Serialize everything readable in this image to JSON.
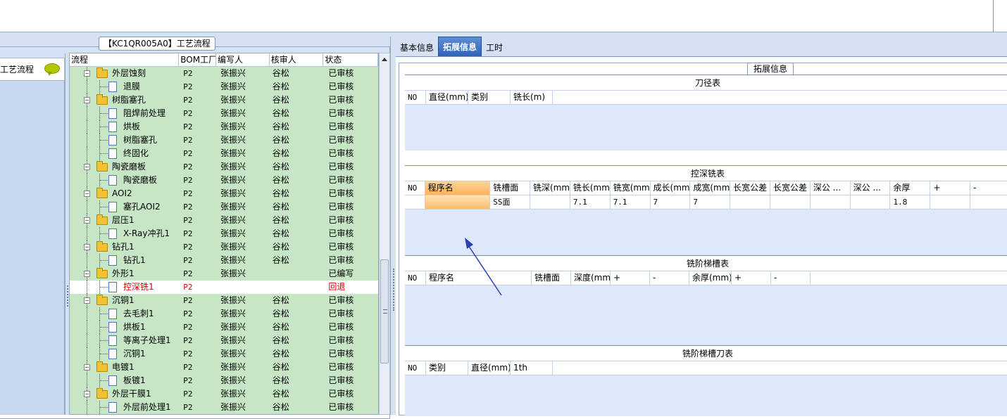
{
  "left_panel": {
    "group_title": "【KC1QR005A0】工艺流程",
    "nav_item_label": "工艺流程",
    "columns": [
      "流程",
      "BOM工厂",
      "编写人",
      "核审人",
      "状态"
    ],
    "rows": [
      {
        "name": "外层蚀刻",
        "level": 1,
        "type": "folder",
        "bom": "P2",
        "writer": "张振兴",
        "reviewer": "谷松",
        "status": "已审核"
      },
      {
        "name": "退膜",
        "level": 2,
        "type": "doc",
        "bom": "P2",
        "writer": "张振兴",
        "reviewer": "谷松",
        "status": "已审核"
      },
      {
        "name": "树脂塞孔",
        "level": 1,
        "type": "folder",
        "bom": "P2",
        "writer": "张振兴",
        "reviewer": "谷松",
        "status": "已审核"
      },
      {
        "name": "阻焊前处理",
        "level": 2,
        "type": "doc",
        "bom": "P2",
        "writer": "张振兴",
        "reviewer": "谷松",
        "status": "已审核"
      },
      {
        "name": "烘板",
        "level": 2,
        "type": "doc",
        "bom": "P2",
        "writer": "张振兴",
        "reviewer": "谷松",
        "status": "已审核"
      },
      {
        "name": "树脂塞孔",
        "level": 2,
        "type": "doc",
        "bom": "P2",
        "writer": "张振兴",
        "reviewer": "谷松",
        "status": "已审核"
      },
      {
        "name": "终固化",
        "level": 2,
        "type": "doc",
        "bom": "P2",
        "writer": "张振兴",
        "reviewer": "谷松",
        "status": "已审核"
      },
      {
        "name": "陶瓷磨板",
        "level": 1,
        "type": "folder",
        "bom": "P2",
        "writer": "张振兴",
        "reviewer": "谷松",
        "status": "已审核"
      },
      {
        "name": "陶瓷磨板",
        "level": 2,
        "type": "doc",
        "bom": "P2",
        "writer": "张振兴",
        "reviewer": "谷松",
        "status": "已审核"
      },
      {
        "name": "AOI2",
        "level": 1,
        "type": "folder",
        "bom": "P2",
        "writer": "张振兴",
        "reviewer": "谷松",
        "status": "已审核"
      },
      {
        "name": "塞孔AOI2",
        "level": 2,
        "type": "doc",
        "bom": "P2",
        "writer": "张振兴",
        "reviewer": "谷松",
        "status": "已审核"
      },
      {
        "name": "层压1",
        "level": 1,
        "type": "folder",
        "bom": "P2",
        "writer": "张振兴",
        "reviewer": "谷松",
        "status": "已审核"
      },
      {
        "name": "X-Ray冲孔1",
        "level": 2,
        "type": "doc",
        "bom": "P2",
        "writer": "张振兴",
        "reviewer": "谷松",
        "status": "已审核"
      },
      {
        "name": "钻孔1",
        "level": 1,
        "type": "folder",
        "bom": "P2",
        "writer": "张振兴",
        "reviewer": "谷松",
        "status": "已审核"
      },
      {
        "name": "钻孔1",
        "level": 2,
        "type": "doc",
        "bom": "P2",
        "writer": "张振兴",
        "reviewer": "谷松",
        "status": "已审核"
      },
      {
        "name": "外形1",
        "level": 1,
        "type": "folder",
        "bom": "P2",
        "writer": "张振兴",
        "reviewer": "",
        "status": "已编写"
      },
      {
        "name": "控深铣1",
        "level": 2,
        "type": "doc",
        "bom": "P2",
        "writer": "",
        "reviewer": "",
        "status": "回退",
        "selected": true
      },
      {
        "name": "沉铜1",
        "level": 1,
        "type": "folder",
        "bom": "P2",
        "writer": "张振兴",
        "reviewer": "谷松",
        "status": "已审核"
      },
      {
        "name": "去毛刺1",
        "level": 2,
        "type": "doc",
        "bom": "P2",
        "writer": "张振兴",
        "reviewer": "谷松",
        "status": "已审核"
      },
      {
        "name": "烘板1",
        "level": 2,
        "type": "doc",
        "bom": "P2",
        "writer": "张振兴",
        "reviewer": "谷松",
        "status": "已审核"
      },
      {
        "name": "等离子处理1",
        "level": 2,
        "type": "doc",
        "bom": "P2",
        "writer": "张振兴",
        "reviewer": "谷松",
        "status": "已审核"
      },
      {
        "name": "沉铜1",
        "level": 2,
        "type": "doc",
        "bom": "P2",
        "writer": "张振兴",
        "reviewer": "谷松",
        "status": "已审核"
      },
      {
        "name": "电镀1",
        "level": 1,
        "type": "folder",
        "bom": "P2",
        "writer": "张振兴",
        "reviewer": "谷松",
        "status": "已审核"
      },
      {
        "name": "板镀1",
        "level": 2,
        "type": "doc",
        "bom": "P2",
        "writer": "张振兴",
        "reviewer": "谷松",
        "status": "已审核"
      },
      {
        "name": "外层干膜1",
        "level": 1,
        "type": "folder",
        "bom": "P2",
        "writer": "张振兴",
        "reviewer": "谷松",
        "status": "已审核"
      },
      {
        "name": "外层前处理1",
        "level": 2,
        "type": "doc",
        "bom": "P2",
        "writer": "张振兴",
        "reviewer": "谷松",
        "status": "已审核"
      }
    ]
  },
  "right_panel": {
    "tabs": [
      "基本信息",
      "拓展信息",
      "工时"
    ],
    "active_tab": "拓展信息",
    "group_title": "拓展信息",
    "sections": {
      "cutter_diameter": {
        "title": "刀径表",
        "columns": [
          "NO",
          "直径(mm)",
          "类别",
          "铣长(m)"
        ]
      },
      "depth_milling": {
        "title": "控深铣表",
        "columns": [
          "NO",
          "程序名",
          "铣槽面",
          "铣深(mm)",
          "铣长(mm)",
          "铣宽(mm)",
          "成长(mm)",
          "成宽(mm)",
          "长宽公差",
          "长宽公差",
          "深公 ...",
          "深公 ...",
          "余厚",
          "+",
          "-"
        ],
        "row": [
          "",
          "",
          "SS面",
          "",
          "7.1",
          "7.1",
          "7",
          "7",
          "",
          "",
          "",
          "",
          "1.8",
          "",
          ""
        ]
      },
      "step_slot": {
        "title": "铣阶梯槽表",
        "columns": [
          "NO",
          "程序名",
          "铣槽面",
          "深度(mm)",
          "+",
          "-",
          "余厚(mm)",
          "+",
          "-"
        ]
      },
      "step_slot_cutter": {
        "title": "铣阶梯槽刀表",
        "columns": [
          "NO",
          "类别",
          "直径(mm)",
          "1th"
        ]
      }
    }
  },
  "colors": {
    "tree_bg": "#c6e6c6",
    "selected_text": "#d00000",
    "active_tab": "#2f62b8",
    "highlight_cell": "#f8b35a",
    "annotation_arrow": "#2b3fb5"
  }
}
